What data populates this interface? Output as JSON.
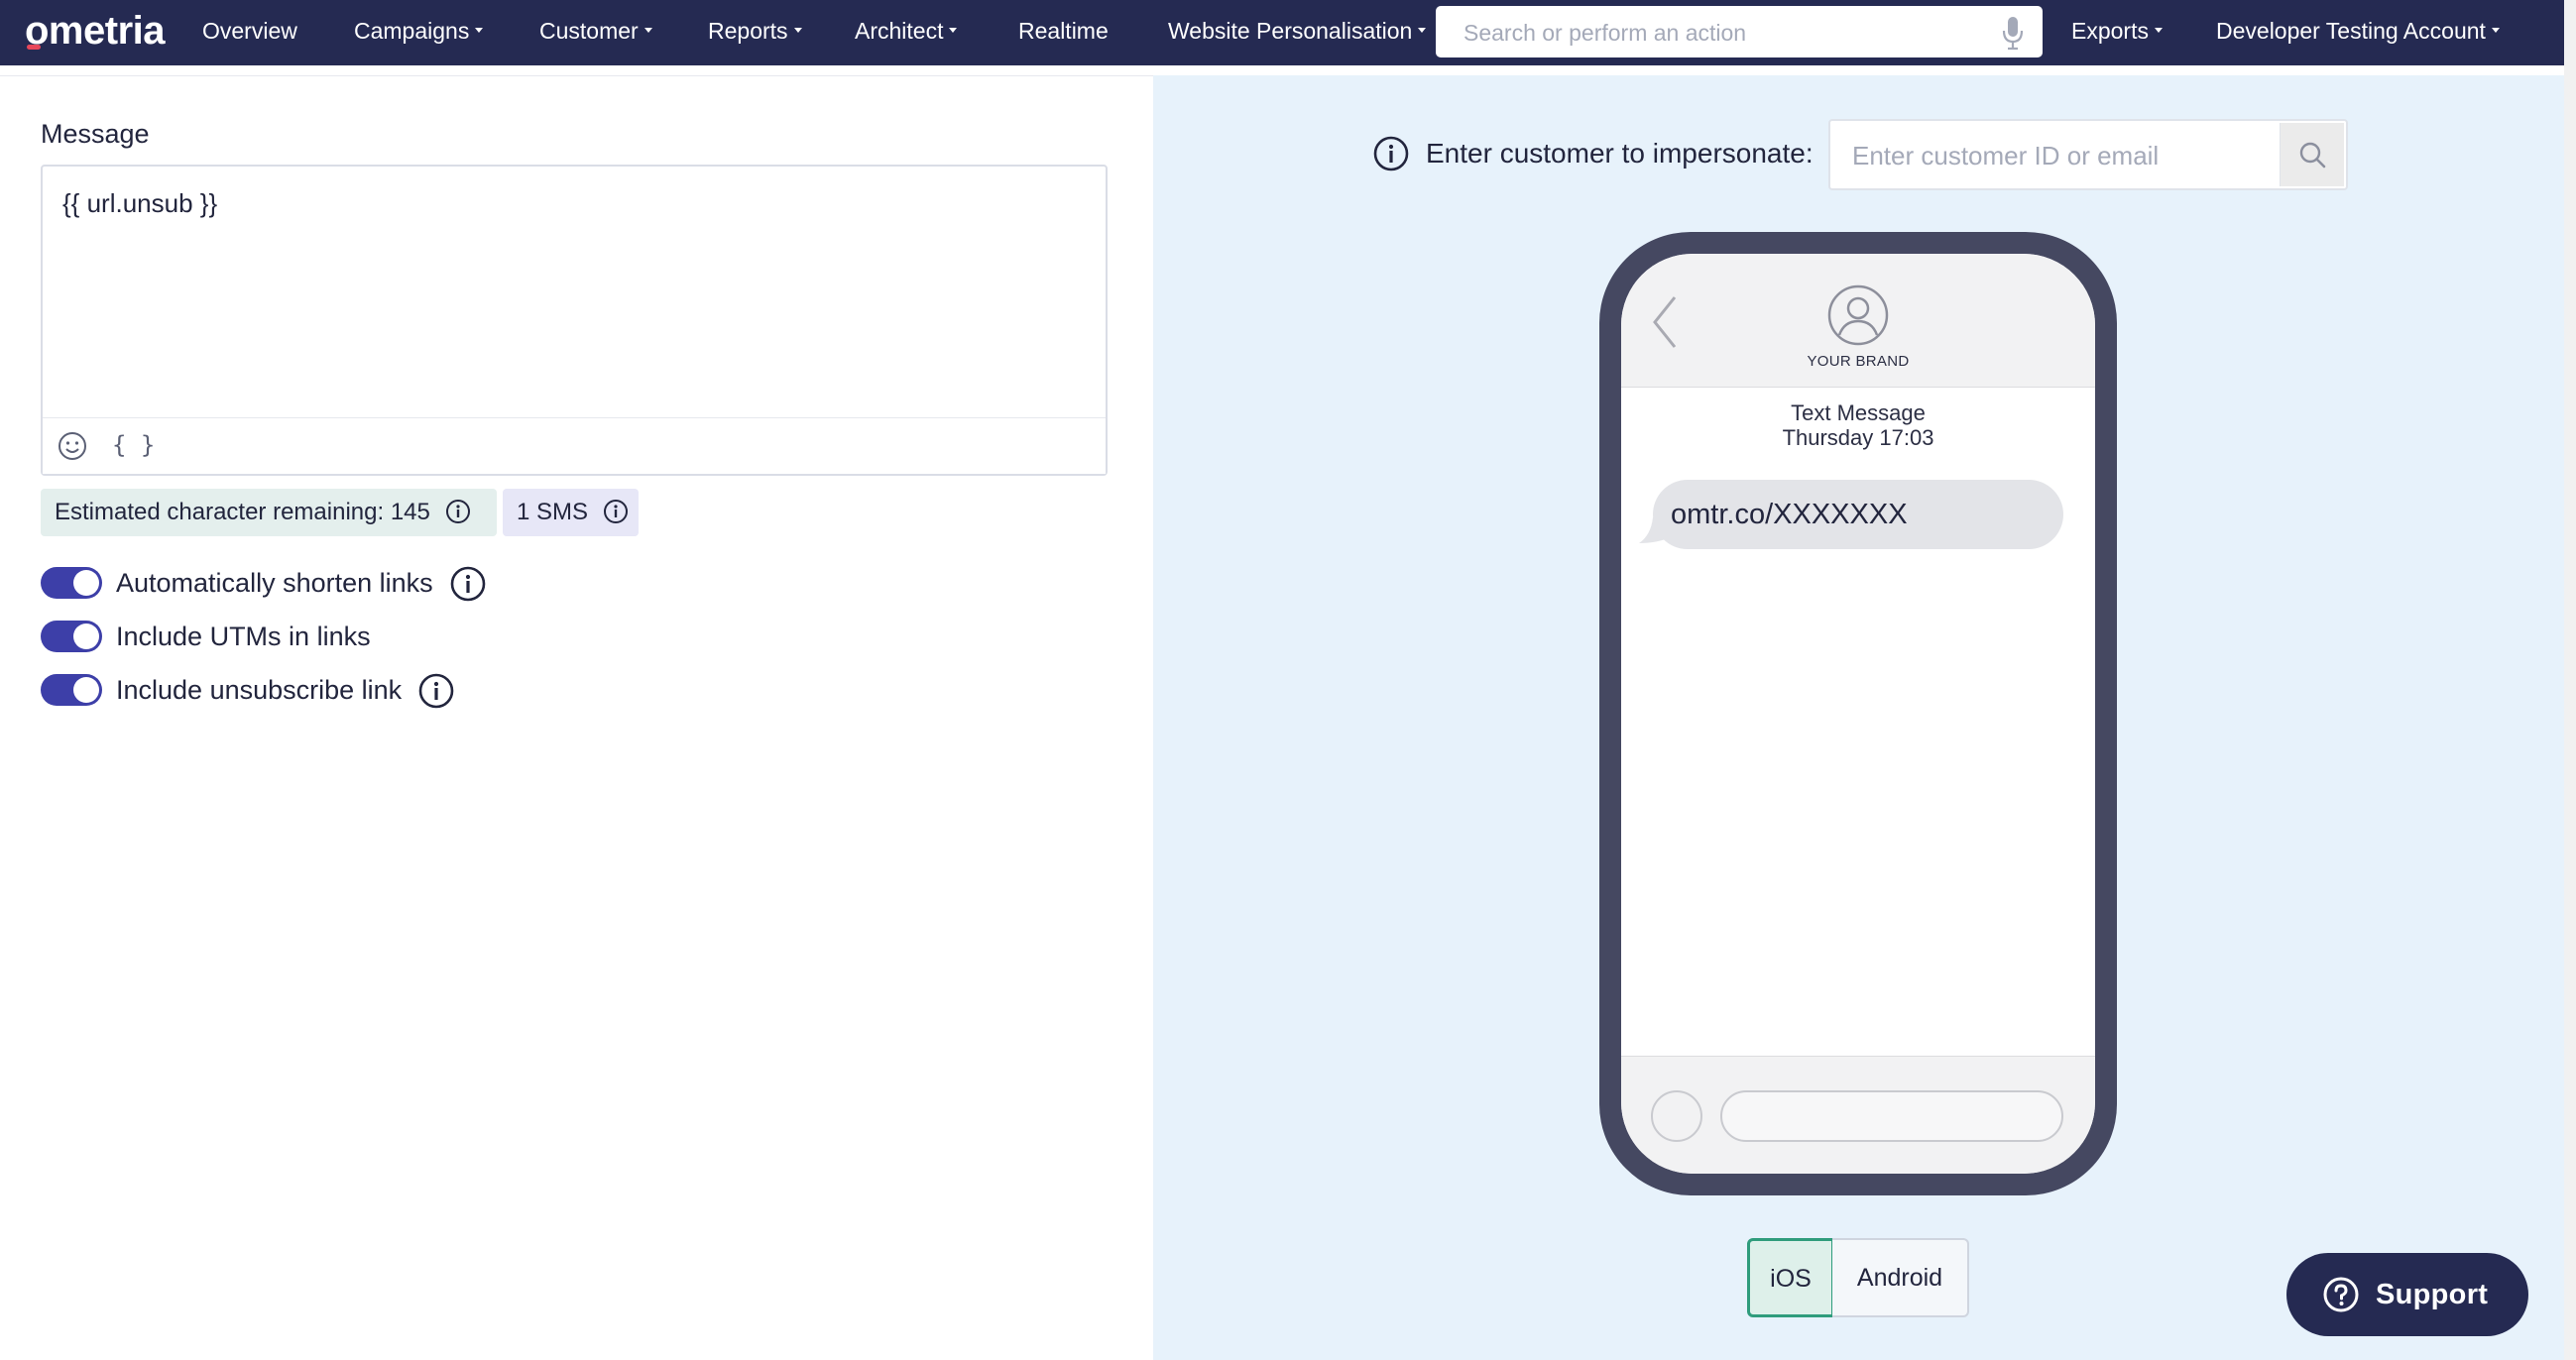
{
  "app": {
    "logo": "ometria"
  },
  "nav": {
    "overview": "Overview",
    "campaigns": "Campaigns",
    "customer": "Customer",
    "reports": "Reports",
    "architect": "Architect",
    "realtime": "Realtime",
    "website_personalisation": "Website Personalisation",
    "search_placeholder": "Search or perform an action",
    "exports": "Exports",
    "account": "Developer Testing Account"
  },
  "editor": {
    "label": "Message",
    "value": "{{ url.unsub }}",
    "braces_button": "{ }",
    "chars_remaining": "Estimated character remaining: 145",
    "sms_count": "1 SMS"
  },
  "toggles": [
    {
      "label": "Automatically shorten links",
      "on": true,
      "has_info": true
    },
    {
      "label": "Include UTMs in links",
      "on": true,
      "has_info": false
    },
    {
      "label": "Include unsubscribe link",
      "on": true,
      "has_info": true
    }
  ],
  "preview": {
    "impersonate_label": "Enter customer to impersonate:",
    "impersonate_placeholder": "Enter customer ID or email",
    "brand": "YOUR BRAND",
    "message_type": "Text Message",
    "timestamp": "Thursday 17:03",
    "bubble_text": "omtr.co/XXXXXXX",
    "platforms": [
      {
        "label": "iOS",
        "selected": true
      },
      {
        "label": "Android",
        "selected": false
      }
    ]
  },
  "support": {
    "label": "Support"
  },
  "colors": {
    "nav_bg": "#252a52",
    "toggle_on": "#3d3fa8",
    "preview_bg": "#e7f2fb",
    "selected_platform_border": "#2f9c7c",
    "logo_accent": "#e8475a"
  }
}
